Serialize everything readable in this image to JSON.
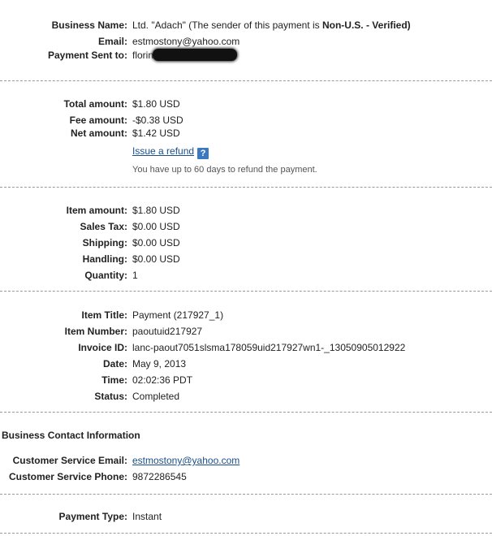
{
  "business": {
    "name_label": "Business Name:",
    "name_value": "Ltd. \"Adach\" (The sender of this payment is ",
    "name_status": "Non-U.S. - Verified)",
    "email_label": "Email:",
    "email_value": "estmostony@yahoo.com",
    "sent_to_label": "Payment Sent to:",
    "sent_to_value": "florin"
  },
  "amounts": {
    "total_label": "Total amount:",
    "total_value": "$1.80 USD",
    "fee_label": "Fee amount:",
    "fee_value": "-$0.38 USD",
    "net_label": "Net amount:",
    "net_value": "$1.42 USD",
    "refund_link": "Issue a refund",
    "help_icon_text": "?",
    "refund_note": "You have up to 60 days to refund the payment."
  },
  "items": {
    "item_amount_label": "Item amount:",
    "item_amount_value": "$1.80 USD",
    "sales_tax_label": "Sales Tax:",
    "sales_tax_value": "$0.00 USD",
    "shipping_label": "Shipping:",
    "shipping_value": "$0.00 USD",
    "handling_label": "Handling:",
    "handling_value": "$0.00 USD",
    "quantity_label": "Quantity:",
    "quantity_value": "1"
  },
  "details": {
    "title_label": "Item Title:",
    "title_value": "Payment (217927_1)",
    "number_label": "Item Number:",
    "number_value": "paoutuid217927",
    "invoice_label": "Invoice ID:",
    "invoice_value": "lanc-paout7051slsma178059uid217927wn1-_13050905012922",
    "date_label": "Date:",
    "date_value": "May 9, 2013",
    "time_label": "Time:",
    "time_value": "02:02:36 PDT",
    "status_label": "Status:",
    "status_value": "Completed"
  },
  "contact": {
    "section_title": "Business Contact Information",
    "cs_email_label": "Customer Service Email:",
    "cs_email_value": "estmostony@yahoo.com",
    "cs_phone_label": "Customer Service Phone:",
    "cs_phone_value": "9872286545"
  },
  "payment": {
    "type_label": "Payment Type:",
    "type_value": "Instant"
  },
  "colors": {
    "link": "#1a4f8b",
    "help_icon": "#3b78c2",
    "separator": "#9a9a9a"
  }
}
